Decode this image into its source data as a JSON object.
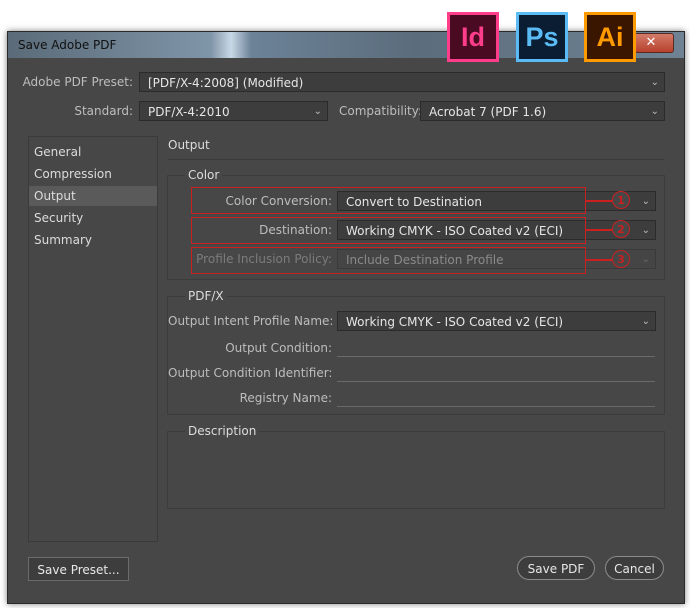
{
  "window": {
    "title": "Save Adobe PDF",
    "close_glyph": "✕"
  },
  "app_icons": [
    {
      "text": "Id",
      "bg": "#4a0a22",
      "fg": "#ff3d8b",
      "border": "#ff3d8b"
    },
    {
      "text": "Ps",
      "bg": "#0a1d33",
      "fg": "#5bbcf5",
      "border": "#5bbcf5"
    },
    {
      "text": "Ai",
      "bg": "#3a1600",
      "fg": "#ff9a00",
      "border": "#ff9a00"
    }
  ],
  "preset": {
    "label": "Adobe PDF Preset:",
    "value": "[PDF/X-4:2008] (Modified)"
  },
  "standard": {
    "label": "Standard:",
    "value": "PDF/X-4:2010"
  },
  "compatibility": {
    "label": "Compatibility:",
    "value": "Acrobat 7 (PDF 1.6)"
  },
  "sidebar": {
    "items": [
      {
        "label": "General"
      },
      {
        "label": "Compression"
      },
      {
        "label": "Output",
        "selected": true
      },
      {
        "label": "Security"
      },
      {
        "label": "Summary"
      }
    ]
  },
  "section_title": "Output",
  "color_group": {
    "title": "Color",
    "conversion": {
      "label": "Color Conversion:",
      "value": "Convert to Destination",
      "marker": "1"
    },
    "destination": {
      "label": "Destination:",
      "value": "Working CMYK - ISO Coated v2 (ECI)",
      "marker": "2"
    },
    "profile_policy": {
      "label": "Profile Inclusion Policy:",
      "value": "Include Destination Profile",
      "marker": "3"
    }
  },
  "pdfx_group": {
    "title": "PDF/X",
    "intent_profile": {
      "label": "Output Intent Profile Name:",
      "value": "Working CMYK - ISO Coated v2 (ECI)"
    },
    "output_condition": {
      "label": "Output Condition:",
      "value": ""
    },
    "condition_identifier": {
      "label": "Output Condition Identifier:",
      "value": ""
    },
    "registry_name": {
      "label": "Registry Name:",
      "value": ""
    }
  },
  "description": {
    "title": "Description",
    "text": ""
  },
  "buttons": {
    "save_preset": "Save Preset...",
    "save_pdf": "Save PDF",
    "cancel": "Cancel"
  },
  "highlight_color": "#cc1f1f"
}
